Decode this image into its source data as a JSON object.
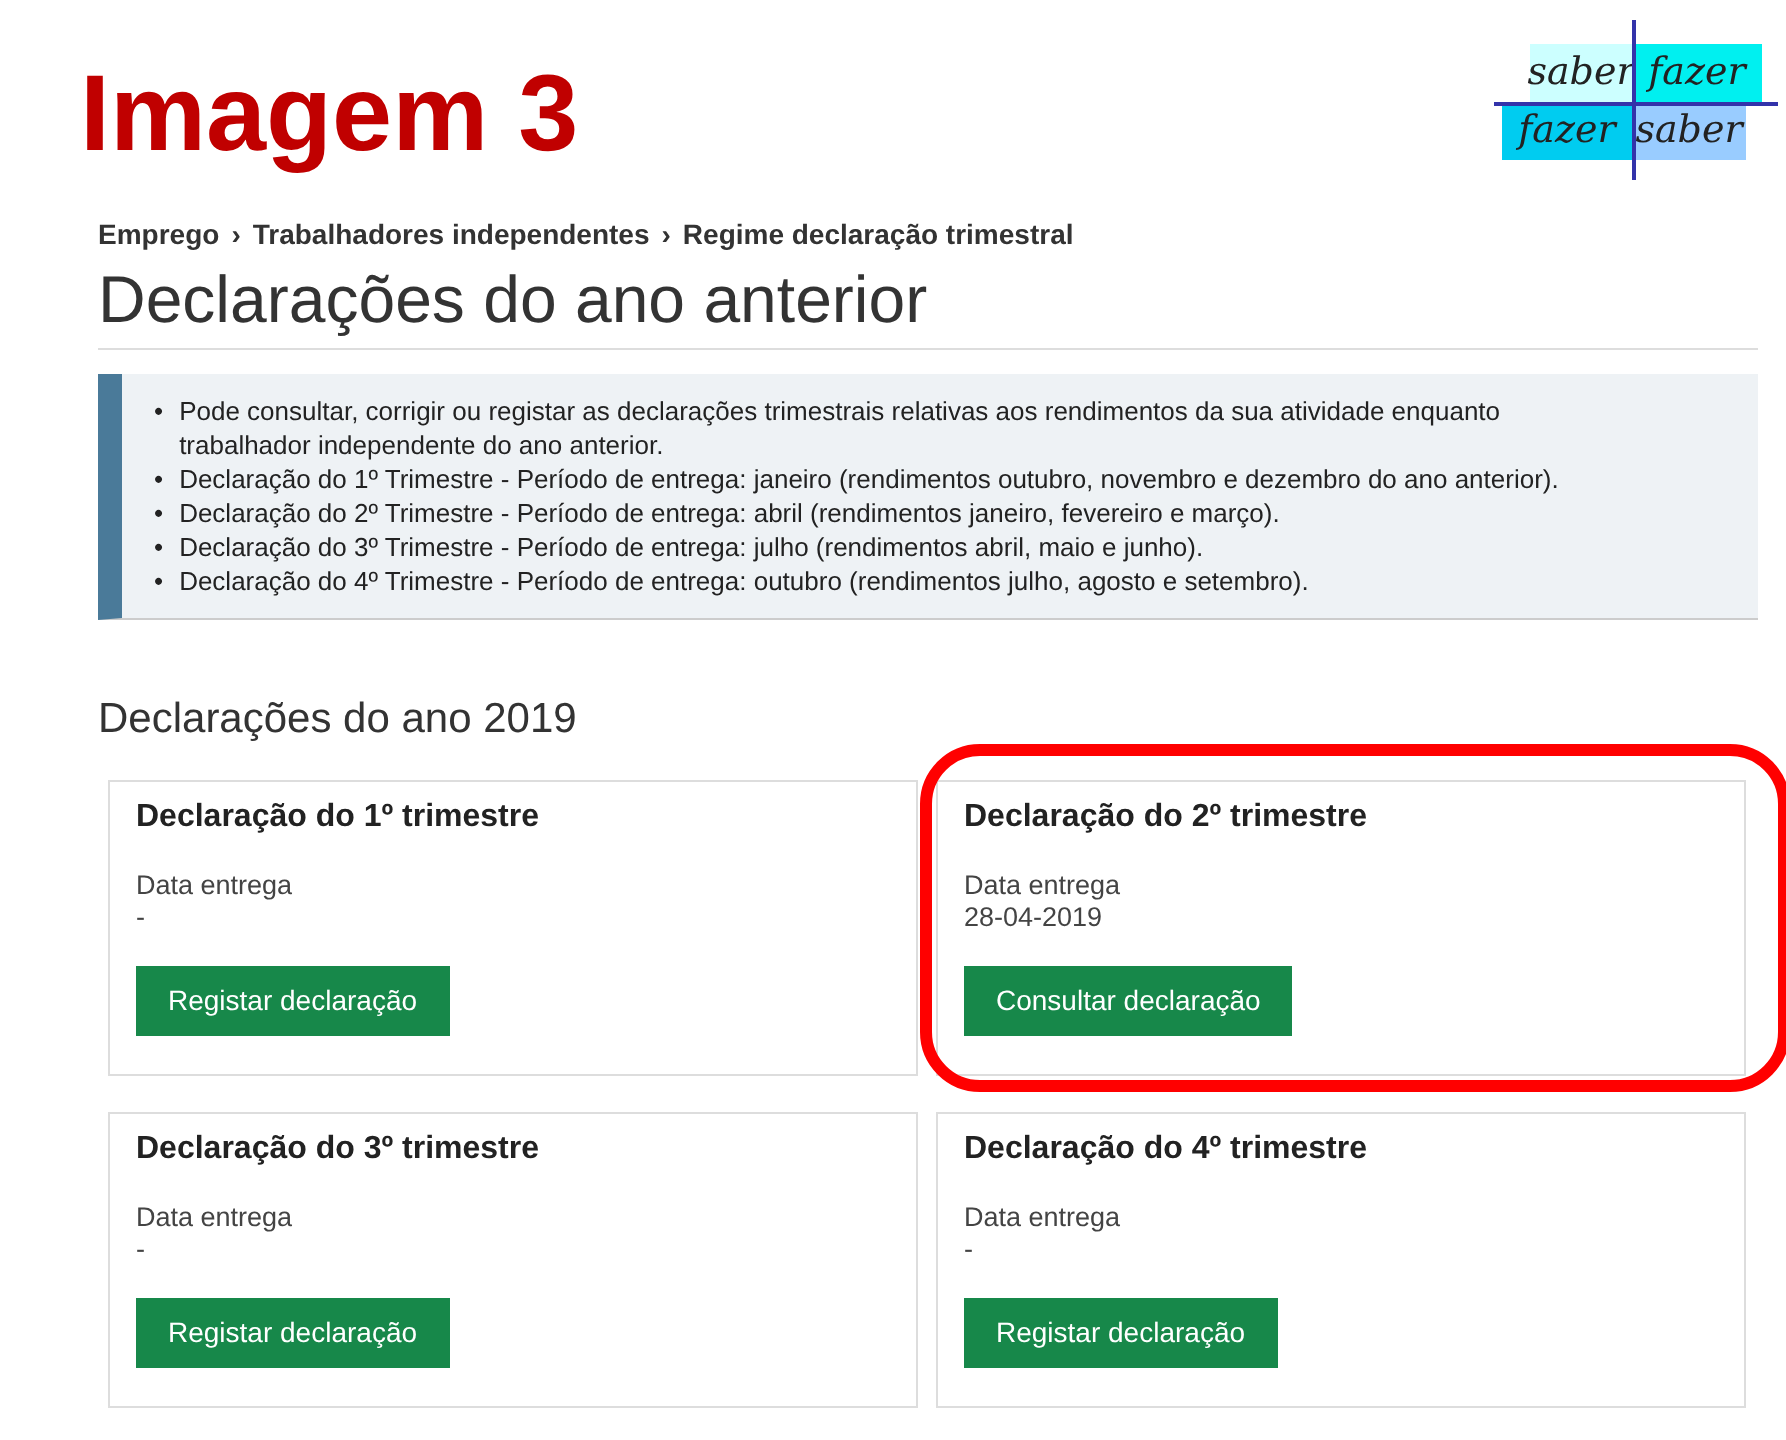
{
  "annotation": {
    "title": "Imagem 3"
  },
  "logo": {
    "cells": [
      {
        "text": "saber",
        "color": "#ccffff"
      },
      {
        "text": "fazer",
        "color": "#00f0f0"
      },
      {
        "text": "fazer",
        "color": "#00ccf0"
      },
      {
        "text": "saber",
        "color": "#99ccff"
      }
    ]
  },
  "breadcrumb": [
    "Emprego",
    "Trabalhadores independentes",
    "Regime declaração trimestral"
  ],
  "breadcrumb_separator": "›",
  "page_title": "Declarações do ano anterior",
  "info_box": {
    "bullet": "•",
    "items": [
      "Pode consultar, corrigir ou registar as declarações trimestrais relativas aos rendimentos da sua atividade enquanto trabalhador independente do ano anterior.",
      "Declaração do 1º Trimestre - Período de entrega: janeiro (rendimentos outubro, novembro e dezembro do ano anterior).",
      "Declaração do 2º Trimestre - Período de entrega: abril (rendimentos janeiro, fevereiro e março).",
      "Declaração do 3º Trimestre - Período de entrega: julho (rendimentos abril, maio e junho).",
      "Declaração do 4º Trimestre - Período de entrega: outubro (rendimentos julho, agosto e setembro)."
    ]
  },
  "section_title": "Declarações do ano 2019",
  "cards": [
    {
      "title": "Declaração do 1º trimestre",
      "label": "Data entrega",
      "value": "-",
      "button": "Registar declaração",
      "highlighted": false
    },
    {
      "title": "Declaração do 2º trimestre",
      "label": "Data entrega",
      "value": "28-04-2019",
      "button": "Consultar declaração",
      "highlighted": true
    },
    {
      "title": "Declaração do 3º trimestre",
      "label": "Data entrega",
      "value": "-",
      "button": "Registar declaração",
      "highlighted": false
    },
    {
      "title": "Declaração do 4º trimestre",
      "label": "Data entrega",
      "value": "-",
      "button": "Registar declaração",
      "highlighted": false
    }
  ]
}
